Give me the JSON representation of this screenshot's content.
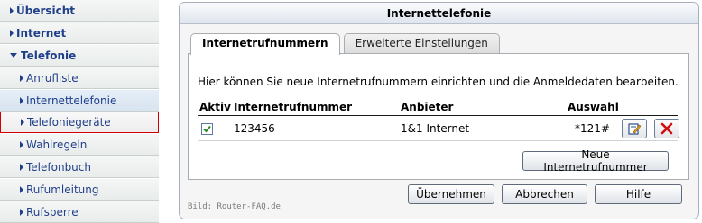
{
  "sidebar": {
    "items": [
      {
        "label": "Übersicht"
      },
      {
        "label": "Internet"
      },
      {
        "label": "Telefonie"
      },
      {
        "label": "Anrufliste"
      },
      {
        "label": "Internettelefonie"
      },
      {
        "label": "Telefoniegeräte"
      },
      {
        "label": "Wahlregeln"
      },
      {
        "label": "Telefonbuch"
      },
      {
        "label": "Rufumleitung"
      },
      {
        "label": "Rufsperre"
      }
    ]
  },
  "panel": {
    "title": "Internettelefonie",
    "tabs": [
      {
        "label": "Internetrufnummern",
        "active": true
      },
      {
        "label": "Erweiterte Einstellungen",
        "active": false
      }
    ],
    "intro": "Hier können Sie neue Internetrufnummern einrichten und die Anmeldedaten bearbeiten.",
    "table": {
      "headers": {
        "aktiv": "Aktiv",
        "nummer": "Internetrufnummer",
        "anbieter": "Anbieter",
        "auswahl": "Auswahl"
      },
      "rows": [
        {
          "aktiv": true,
          "nummer": "123456",
          "anbieter": "1&1 Internet",
          "auswahl": "*121#"
        }
      ]
    },
    "new_number_button": "Neue Internetrufnummer",
    "apply_button": "Übernehmen",
    "cancel_button": "Abbrechen",
    "help_button": "Hilfe",
    "credit": "Bild: Router-FAQ.de"
  },
  "colors": {
    "nav_text": "#1f3f8a",
    "highlight_border": "#d00000",
    "check_green": "#2f8a2f",
    "delete_red": "#d01010"
  }
}
